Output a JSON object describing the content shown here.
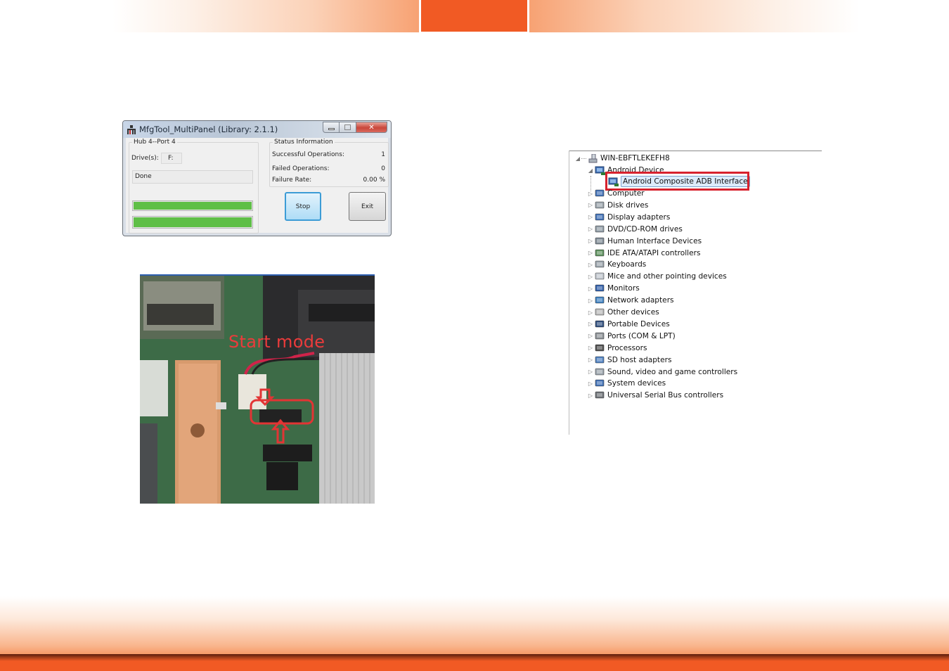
{
  "header": {
    "accent_color": "#f15a24"
  },
  "mfgtool_window": {
    "title": "MfgTool_MultiPanel (Library: 2.1.1)",
    "window_buttons": {
      "minimize": "minimize-icon",
      "maximize": "maximize-icon",
      "close": "✕"
    },
    "port_group_label": "Hub 4--Port 4",
    "drive_label": "Drive(s):",
    "drive_value": "F:",
    "status_message": "Done",
    "progress_bars": [
      {
        "name": "phase-progress",
        "percent": 100
      },
      {
        "name": "total-progress",
        "percent": 100
      }
    ],
    "status_group_label": "Status Information",
    "stats": [
      {
        "label": "Successful Operations:",
        "value": "1"
      },
      {
        "label": "Failed Operations:",
        "value": "0"
      },
      {
        "label": "Failure Rate:",
        "value": "0.00 %"
      }
    ],
    "stop_button": "Stop",
    "exit_button": "Exit"
  },
  "board_photo": {
    "annotation": "Start mode"
  },
  "device_manager": {
    "root": "WIN-EBFTLEKEFH8",
    "expanded_category": "Android Device",
    "selected_device": "Android Composite ADB Interface",
    "categories": [
      {
        "label": "Computer",
        "icon": "computer-icon"
      },
      {
        "label": "Disk drives",
        "icon": "disk-drive-icon"
      },
      {
        "label": "Display adapters",
        "icon": "display-adapter-icon"
      },
      {
        "label": "DVD/CD-ROM drives",
        "icon": "dvd-drive-icon"
      },
      {
        "label": "Human Interface Devices",
        "icon": "hid-icon"
      },
      {
        "label": "IDE ATA/ATAPI controllers",
        "icon": "ide-controller-icon"
      },
      {
        "label": "Keyboards",
        "icon": "keyboard-icon"
      },
      {
        "label": "Mice and other pointing devices",
        "icon": "mouse-icon"
      },
      {
        "label": "Monitors",
        "icon": "monitor-icon"
      },
      {
        "label": "Network adapters",
        "icon": "network-adapter-icon"
      },
      {
        "label": "Other devices",
        "icon": "other-devices-icon"
      },
      {
        "label": "Portable Devices",
        "icon": "portable-device-icon"
      },
      {
        "label": "Ports (COM & LPT)",
        "icon": "port-icon"
      },
      {
        "label": "Processors",
        "icon": "processor-icon"
      },
      {
        "label": "SD host adapters",
        "icon": "sd-adapter-icon"
      },
      {
        "label": "Sound, video and game controllers",
        "icon": "sound-icon"
      },
      {
        "label": "System devices",
        "icon": "system-devices-icon"
      },
      {
        "label": "Universal Serial Bus controllers",
        "icon": "usb-icon"
      }
    ],
    "highlight_color": "#d7222e"
  }
}
